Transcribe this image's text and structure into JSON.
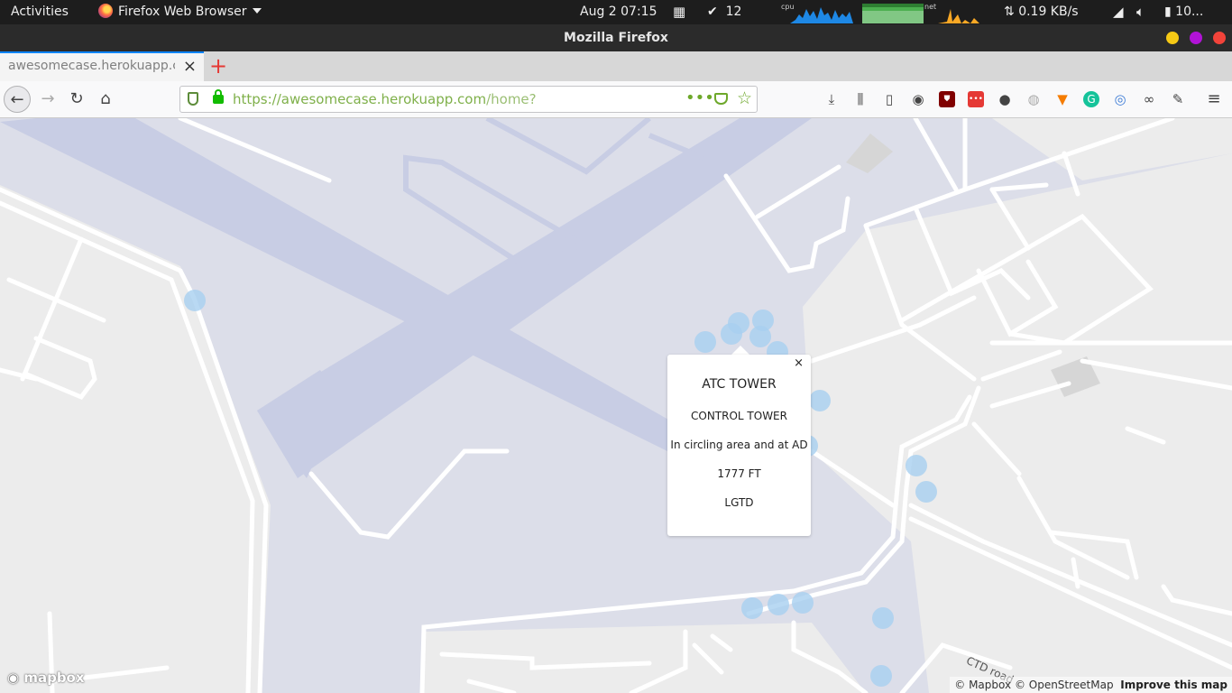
{
  "topbar": {
    "activities": "Activities",
    "app_menu": "Firefox Web Browser",
    "clock": "Aug 2  07:15",
    "tasks_count": "12",
    "cpu_label": "cpu",
    "net_label": "net",
    "net_speed": "0.19 KB/s",
    "battery": "10..."
  },
  "window": {
    "title": "Mozilla Firefox"
  },
  "tab": {
    "title": "awesomecase.herokuapp.com",
    "close": "×",
    "new_tab": "+"
  },
  "navbar": {
    "url_scheme": "https://",
    "url_host": "awesomecase.herokuapp.com",
    "url_path": "/home?",
    "page_actions": "•••"
  },
  "popup": {
    "close": "×",
    "title": "ATC TOWER",
    "line1": "CONTROL TOWER",
    "line2": "In circling area and at AD",
    "line3": "1777 FT",
    "line4": "LGTD"
  },
  "map": {
    "logo": "mapbox",
    "attribution_mapbox": "© Mapbox",
    "attribution_osm": "© OpenStreetMap",
    "improve": "Improve this map",
    "road_label": "CTD road",
    "marker_color": "#a8cff0"
  },
  "colors": {
    "accent": "#0a84ff",
    "secure_green": "#7fb04a"
  }
}
